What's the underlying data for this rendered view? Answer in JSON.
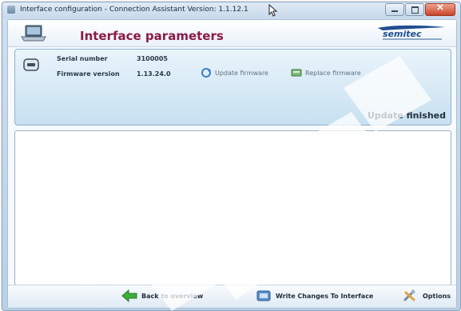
{
  "window": {
    "title": "Interface configuration - Connection Assistant Version: 1.1.12.1"
  },
  "header": {
    "title": "Interface parameters",
    "logo_icon": "semitec-logo-icon"
  },
  "device": {
    "serial_label": "Serial number",
    "serial_value": "3100005",
    "firmware_label": "Firmware version",
    "firmware_value": "1.13.24.0",
    "update_firmware_label": "Update firmware",
    "replace_firmware_label": "Replace firmware",
    "status_text": "Update finished"
  },
  "footer": {
    "back_label": "Back to overview",
    "write_label": "Write Changes To Interface",
    "options_label": "Options"
  },
  "colors": {
    "title_accent": "#8b1a47",
    "panel_bg": "#c7e0f0",
    "logo_blue": "#1f4f8f"
  }
}
